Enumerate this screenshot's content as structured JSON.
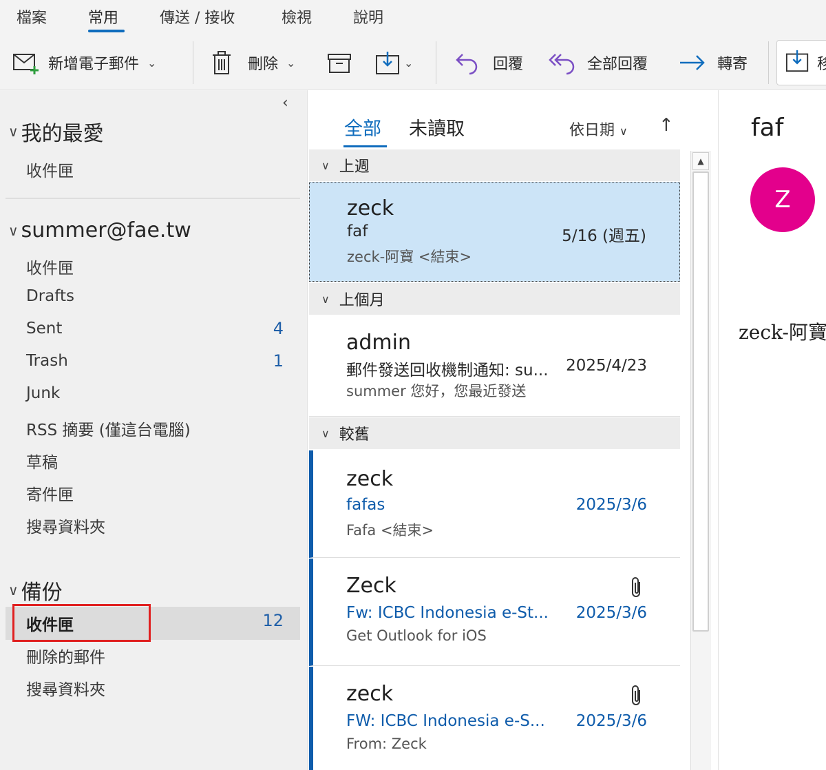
{
  "menu": {
    "tabs": [
      {
        "label": "檔案"
      },
      {
        "label": "常用"
      },
      {
        "label": "傳送 / 接收"
      },
      {
        "label": "檢視"
      },
      {
        "label": "說明"
      }
    ]
  },
  "ribbon": {
    "new_email": "新增電子郵件",
    "delete": "刪除",
    "reply": "回覆",
    "reply_all": "全部回覆",
    "forward": "轉寄",
    "move": "移"
  },
  "folders": {
    "favorites": {
      "title": "我的最愛",
      "items": [
        {
          "label": "收件匣"
        }
      ]
    },
    "account": {
      "title": "summer@fae.tw",
      "items": [
        {
          "label": "收件匣",
          "count": ""
        },
        {
          "label": "Drafts",
          "count": ""
        },
        {
          "label": "Sent",
          "count": "4"
        },
        {
          "label": "Trash",
          "count": "1"
        },
        {
          "label": "Junk",
          "count": ""
        },
        {
          "label": "RSS 摘要 (僅這台電腦)",
          "count": ""
        },
        {
          "label": "草稿",
          "count": ""
        },
        {
          "label": "寄件匣",
          "count": ""
        },
        {
          "label": "搜尋資料夾",
          "count": ""
        }
      ]
    },
    "backup": {
      "title": "備份",
      "items": [
        {
          "label": "收件匣",
          "count": "12"
        },
        {
          "label": "刪除的郵件",
          "count": ""
        },
        {
          "label": "搜尋資料夾",
          "count": ""
        }
      ]
    }
  },
  "list": {
    "tab_all": "全部",
    "tab_unread": "未讀取",
    "sort_by": "依日期",
    "groups": {
      "last_week": "上週",
      "last_month": "上個月",
      "older": "較舊"
    },
    "messages": [
      {
        "from": "zeck",
        "subject": "faf",
        "preview": "zeck-阿寶 <結束>",
        "date": "5/16 (週五)"
      },
      {
        "from": "admin",
        "subject": "郵件發送回收機制通知: su...",
        "preview": "summer 您好，您最近發送",
        "date": "2025/4/23"
      },
      {
        "from": "zeck",
        "subject": "fafas",
        "preview": "Fafa <結束>",
        "date": "2025/3/6"
      },
      {
        "from": "Zeck",
        "subject": "Fw: ICBC Indonesia e-St...",
        "preview": "Get Outlook for iOS",
        "date": "2025/3/6"
      },
      {
        "from": "zeck",
        "subject": "FW: ICBC Indonesia e-S...",
        "preview": "From: Zeck",
        "date": "2025/3/6"
      }
    ]
  },
  "reading": {
    "subject": "faf",
    "avatar_initial": "Z",
    "sender_text": "zeck-阿寶"
  },
  "colors": {
    "accent": "#0f6cbd",
    "avatar": "#e3008c",
    "selected_message": "#cce4f7",
    "highlight_box": "#e02020"
  }
}
